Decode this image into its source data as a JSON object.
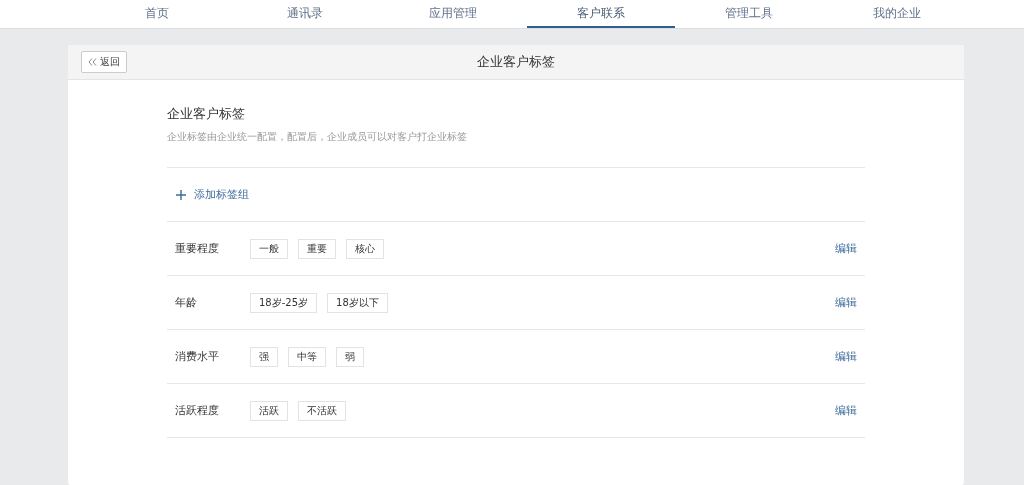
{
  "nav": [
    {
      "label": "首页",
      "selected": false
    },
    {
      "label": "通讯录",
      "selected": false
    },
    {
      "label": "应用管理",
      "selected": false
    },
    {
      "label": "客户联系",
      "selected": true
    },
    {
      "label": "管理工具",
      "selected": false
    },
    {
      "label": "我的企业",
      "selected": false
    }
  ],
  "header": {
    "back": "返回",
    "title": "企业客户标签"
  },
  "section": {
    "title": "企业客户标签",
    "description": "企业标签由企业统一配置，配置后，企业成员可以对客户打企业标签"
  },
  "add_group": "添加标签组",
  "groups": [
    {
      "name": "重要程度",
      "tags": [
        "一般",
        "重要",
        "核心"
      ],
      "action": "编辑"
    },
    {
      "name": "年龄",
      "tags": [
        "18岁-25岁",
        "18岁以下"
      ],
      "action": "编辑"
    },
    {
      "name": "消费水平",
      "tags": [
        "强",
        "中等",
        "弱"
      ],
      "action": "编辑"
    },
    {
      "name": "活跃程度",
      "tags": [
        "活跃",
        "不活跃"
      ],
      "action": "编辑"
    }
  ]
}
